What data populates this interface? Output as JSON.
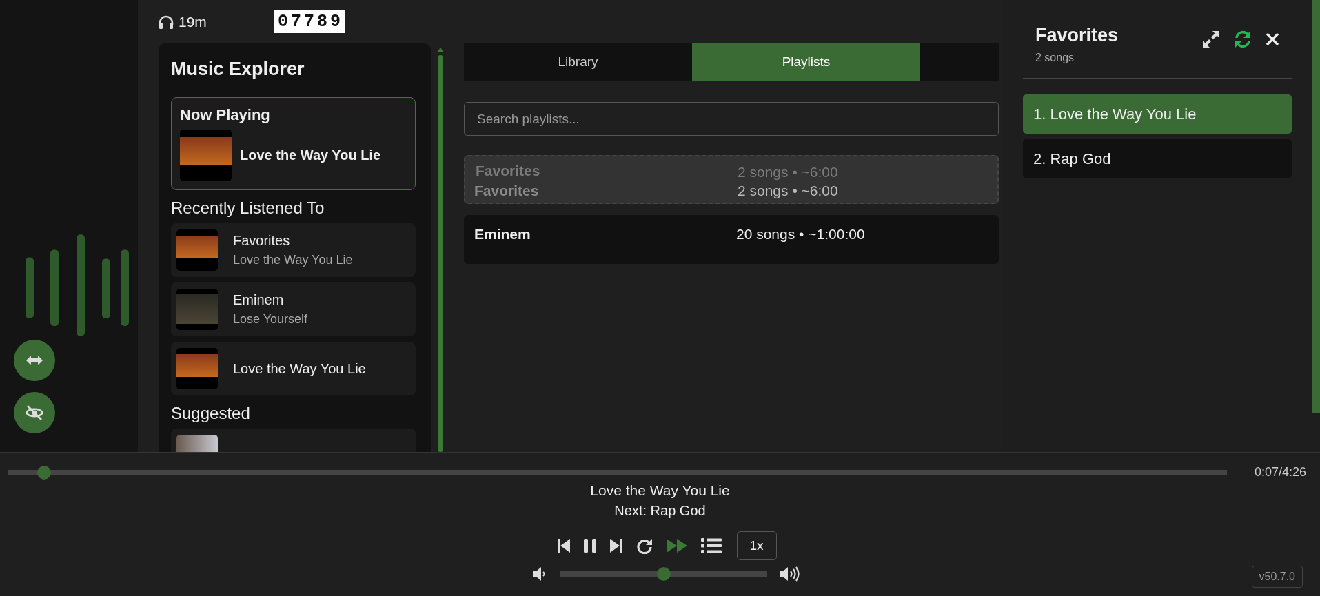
{
  "header": {
    "listen_time": "19m",
    "counter": "07789"
  },
  "sidebar": {
    "title": "Music Explorer",
    "now_playing": {
      "heading": "Now Playing",
      "title": "Love the Way You Lie"
    },
    "recent_heading": "Recently Listened To",
    "recent": [
      {
        "title": "Favorites",
        "subtitle": "Love the Way You Lie"
      },
      {
        "title": "Eminem",
        "subtitle": "Lose Yourself"
      },
      {
        "title": "Love the Way You Lie"
      }
    ],
    "suggested_heading": "Suggested"
  },
  "tabs": [
    {
      "label": "Library",
      "selected": false
    },
    {
      "label": "Playlists",
      "selected": true
    }
  ],
  "search": {
    "placeholder": "Search playlists..."
  },
  "playlists": [
    {
      "name": "Favorites",
      "info": "2 songs • ~6:00",
      "dragging": true
    },
    {
      "name": "Eminem",
      "info": "20 songs • ~1:00:00",
      "dragging": false
    }
  ],
  "drag_ghost": {
    "name": "Favorites",
    "info": "2 songs • ~6:00"
  },
  "queue_panel": {
    "title": "Favorites",
    "count": "2 songs",
    "songs": [
      {
        "label": "1. Love the Way You Lie",
        "selected": true
      },
      {
        "label": "2. Rap God",
        "selected": false
      }
    ]
  },
  "player": {
    "progress": {
      "level": 0.03
    },
    "time": "0:07/4:26",
    "title": "Love the Way You Lie",
    "next": "Next: Rap God",
    "autoplay": true,
    "speed": "1x",
    "volume": {
      "level": 0.5
    }
  },
  "version": "v50.7.0"
}
